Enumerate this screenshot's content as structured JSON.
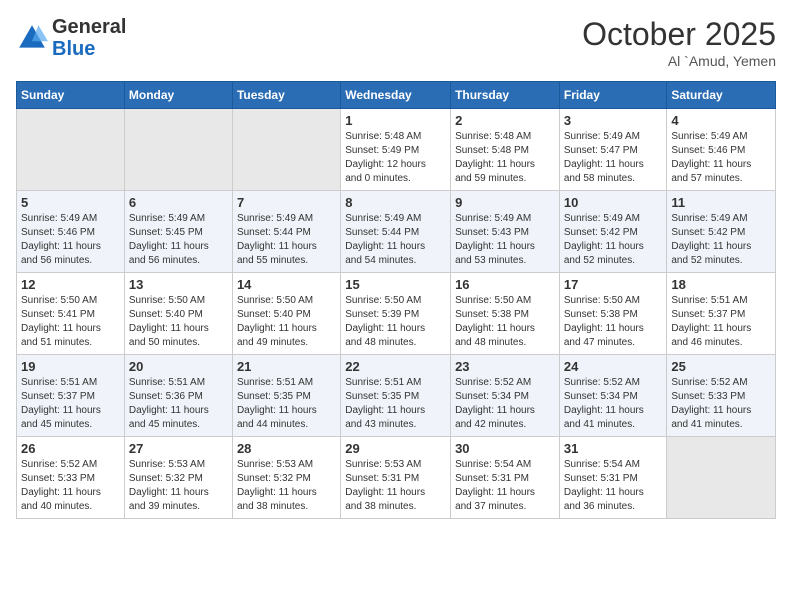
{
  "header": {
    "logo_general": "General",
    "logo_blue": "Blue",
    "month_title": "October 2025",
    "location": "Al `Amud, Yemen"
  },
  "calendar": {
    "days_of_week": [
      "Sunday",
      "Monday",
      "Tuesday",
      "Wednesday",
      "Thursday",
      "Friday",
      "Saturday"
    ],
    "weeks": [
      [
        {
          "day": "",
          "info": ""
        },
        {
          "day": "",
          "info": ""
        },
        {
          "day": "",
          "info": ""
        },
        {
          "day": "1",
          "info": "Sunrise: 5:48 AM\nSunset: 5:49 PM\nDaylight: 12 hours\nand 0 minutes."
        },
        {
          "day": "2",
          "info": "Sunrise: 5:48 AM\nSunset: 5:48 PM\nDaylight: 11 hours\nand 59 minutes."
        },
        {
          "day": "3",
          "info": "Sunrise: 5:49 AM\nSunset: 5:47 PM\nDaylight: 11 hours\nand 58 minutes."
        },
        {
          "day": "4",
          "info": "Sunrise: 5:49 AM\nSunset: 5:46 PM\nDaylight: 11 hours\nand 57 minutes."
        }
      ],
      [
        {
          "day": "5",
          "info": "Sunrise: 5:49 AM\nSunset: 5:46 PM\nDaylight: 11 hours\nand 56 minutes."
        },
        {
          "day": "6",
          "info": "Sunrise: 5:49 AM\nSunset: 5:45 PM\nDaylight: 11 hours\nand 56 minutes."
        },
        {
          "day": "7",
          "info": "Sunrise: 5:49 AM\nSunset: 5:44 PM\nDaylight: 11 hours\nand 55 minutes."
        },
        {
          "day": "8",
          "info": "Sunrise: 5:49 AM\nSunset: 5:44 PM\nDaylight: 11 hours\nand 54 minutes."
        },
        {
          "day": "9",
          "info": "Sunrise: 5:49 AM\nSunset: 5:43 PM\nDaylight: 11 hours\nand 53 minutes."
        },
        {
          "day": "10",
          "info": "Sunrise: 5:49 AM\nSunset: 5:42 PM\nDaylight: 11 hours\nand 52 minutes."
        },
        {
          "day": "11",
          "info": "Sunrise: 5:49 AM\nSunset: 5:42 PM\nDaylight: 11 hours\nand 52 minutes."
        }
      ],
      [
        {
          "day": "12",
          "info": "Sunrise: 5:50 AM\nSunset: 5:41 PM\nDaylight: 11 hours\nand 51 minutes."
        },
        {
          "day": "13",
          "info": "Sunrise: 5:50 AM\nSunset: 5:40 PM\nDaylight: 11 hours\nand 50 minutes."
        },
        {
          "day": "14",
          "info": "Sunrise: 5:50 AM\nSunset: 5:40 PM\nDaylight: 11 hours\nand 49 minutes."
        },
        {
          "day": "15",
          "info": "Sunrise: 5:50 AM\nSunset: 5:39 PM\nDaylight: 11 hours\nand 48 minutes."
        },
        {
          "day": "16",
          "info": "Sunrise: 5:50 AM\nSunset: 5:38 PM\nDaylight: 11 hours\nand 48 minutes."
        },
        {
          "day": "17",
          "info": "Sunrise: 5:50 AM\nSunset: 5:38 PM\nDaylight: 11 hours\nand 47 minutes."
        },
        {
          "day": "18",
          "info": "Sunrise: 5:51 AM\nSunset: 5:37 PM\nDaylight: 11 hours\nand 46 minutes."
        }
      ],
      [
        {
          "day": "19",
          "info": "Sunrise: 5:51 AM\nSunset: 5:37 PM\nDaylight: 11 hours\nand 45 minutes."
        },
        {
          "day": "20",
          "info": "Sunrise: 5:51 AM\nSunset: 5:36 PM\nDaylight: 11 hours\nand 45 minutes."
        },
        {
          "day": "21",
          "info": "Sunrise: 5:51 AM\nSunset: 5:35 PM\nDaylight: 11 hours\nand 44 minutes."
        },
        {
          "day": "22",
          "info": "Sunrise: 5:51 AM\nSunset: 5:35 PM\nDaylight: 11 hours\nand 43 minutes."
        },
        {
          "day": "23",
          "info": "Sunrise: 5:52 AM\nSunset: 5:34 PM\nDaylight: 11 hours\nand 42 minutes."
        },
        {
          "day": "24",
          "info": "Sunrise: 5:52 AM\nSunset: 5:34 PM\nDaylight: 11 hours\nand 41 minutes."
        },
        {
          "day": "25",
          "info": "Sunrise: 5:52 AM\nSunset: 5:33 PM\nDaylight: 11 hours\nand 41 minutes."
        }
      ],
      [
        {
          "day": "26",
          "info": "Sunrise: 5:52 AM\nSunset: 5:33 PM\nDaylight: 11 hours\nand 40 minutes."
        },
        {
          "day": "27",
          "info": "Sunrise: 5:53 AM\nSunset: 5:32 PM\nDaylight: 11 hours\nand 39 minutes."
        },
        {
          "day": "28",
          "info": "Sunrise: 5:53 AM\nSunset: 5:32 PM\nDaylight: 11 hours\nand 38 minutes."
        },
        {
          "day": "29",
          "info": "Sunrise: 5:53 AM\nSunset: 5:31 PM\nDaylight: 11 hours\nand 38 minutes."
        },
        {
          "day": "30",
          "info": "Sunrise: 5:54 AM\nSunset: 5:31 PM\nDaylight: 11 hours\nand 37 minutes."
        },
        {
          "day": "31",
          "info": "Sunrise: 5:54 AM\nSunset: 5:31 PM\nDaylight: 11 hours\nand 36 minutes."
        },
        {
          "day": "",
          "info": ""
        }
      ]
    ]
  }
}
